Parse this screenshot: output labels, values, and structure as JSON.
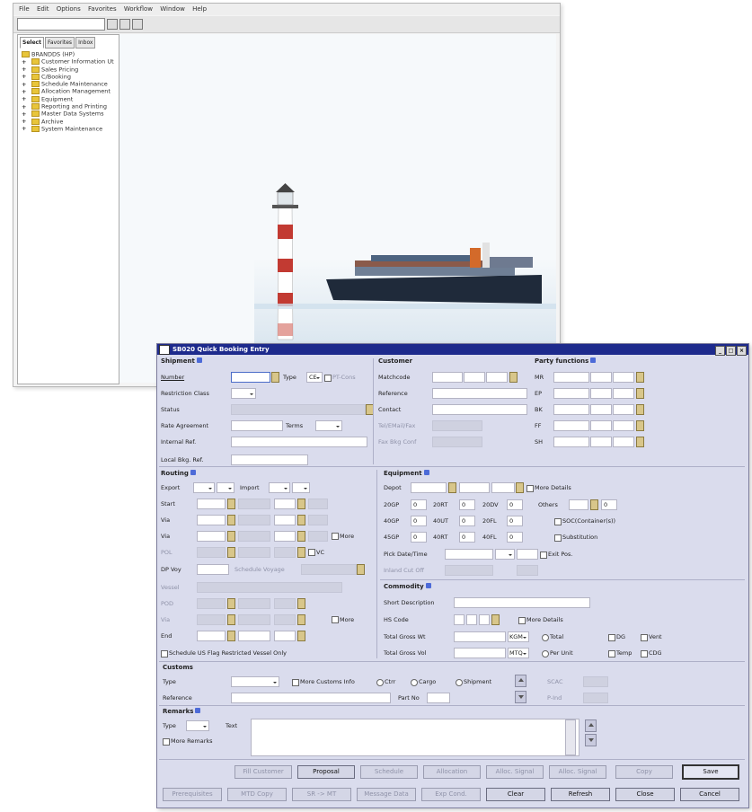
{
  "main": {
    "menu": [
      "File",
      "Edit",
      "Options",
      "Favorites",
      "Workflow",
      "Window",
      "Help"
    ],
    "left_tabs": [
      "Select",
      "Favorites",
      "Inbox"
    ],
    "tree_root": "BRANDDS (HP)",
    "tree_items": [
      "Customer Information Ut",
      "Sales Pricing",
      "C/Booking",
      "Schedule Maintenance",
      "Allocation Management",
      "Equipment",
      "Reporting and Printing",
      "Master Data Systems",
      "Archive",
      "System Maintenance"
    ]
  },
  "dialog": {
    "title": "SB020 Quick Booking Entry",
    "shipment": {
      "title": "Shipment",
      "number": "Number",
      "type": "Type",
      "type_value": "CE",
      "pt_cons": "PT-Cons",
      "restriction_class": "Restriction Class",
      "status": "Status",
      "rate_agreement": "Rate Agreement",
      "terms": "Terms",
      "internal_ref": "Internal Ref.",
      "local_bkg_ref": "Local Bkg. Ref."
    },
    "customer": {
      "title": "Customer",
      "matchcode": "Matchcode",
      "reference": "Reference",
      "contact": "Contact",
      "tel_email_fax": "Tel/EMail/Fax",
      "fax_bkg_conf": "Fax Bkg Conf"
    },
    "party": {
      "title": "Party functions",
      "labels": [
        "MR",
        "EP",
        "BK",
        "FF",
        "SH"
      ]
    },
    "routing": {
      "title": "Routing",
      "export": "Export",
      "import": "Import",
      "rows": [
        "Start",
        "Via",
        "Via",
        "POL"
      ],
      "more": "More",
      "vc": "VC",
      "dp_voy": "DP Voy",
      "schedule_voyage": "Schedule Voyage",
      "rows2": [
        "Vessel",
        "POD",
        "Via",
        "End"
      ],
      "more2": "More",
      "schedule_us_flag": "Schedule US Flag Restricted Vessel Only"
    },
    "equipment": {
      "title": "Equipment",
      "depot": "Depot",
      "more_details": "More Details",
      "sizes": [
        [
          "20GP",
          "0",
          "20RT",
          "0",
          "20DV",
          "0"
        ],
        [
          "40GP",
          "0",
          "40UT",
          "0",
          "20FL",
          "0"
        ],
        [
          "45GP",
          "0",
          "40RT",
          "0",
          "40FL",
          "0"
        ]
      ],
      "others": "Others",
      "others_value": "0",
      "soc": "SOC(Container(s))",
      "substitution": "Substitution",
      "pick_date_time": "Pick Date/Time",
      "exit_pos": "Exit Pos.",
      "inland_cut_off": "Inland Cut Off"
    },
    "commodity": {
      "title": "Commodity",
      "short_description": "Short Description",
      "hs_code": "HS Code",
      "more_details": "More Details",
      "total_gross_wt": "Total Gross Wt",
      "gross_unit": "KGM",
      "total": "Total",
      "dg": "DG",
      "vent": "Vent",
      "total_gross_vol": "Total Gross Vol",
      "vol_unit": "MTQ",
      "per_unit": "Per Unit",
      "temp": "Temp",
      "cdg": "CDG"
    },
    "customs": {
      "title": "Customs",
      "type": "Type",
      "more_customs_info": "More Customs Info",
      "ctrr": "Ctrr",
      "cargo": "Cargo",
      "shipment": "Shipment",
      "scac": "SCAC",
      "reference": "Reference",
      "part_no": "Part No",
      "p_ind": "P-Ind"
    },
    "remarks": {
      "title": "Remarks",
      "type": "Type",
      "text": "Text",
      "more_remarks": "More Remarks"
    },
    "buttons_row1": [
      "Fill Customer",
      "Proposal",
      "Schedule",
      "Allocation",
      "Alloc. Signal",
      "Alloc. Signal",
      "Copy",
      "Save"
    ],
    "buttons_row2": [
      "Prerequisites",
      "MTD Copy",
      "SR -> MT",
      "Message Data",
      "Exp Cond.",
      "Clear",
      "Refresh",
      "Close",
      "Cancel"
    ]
  }
}
